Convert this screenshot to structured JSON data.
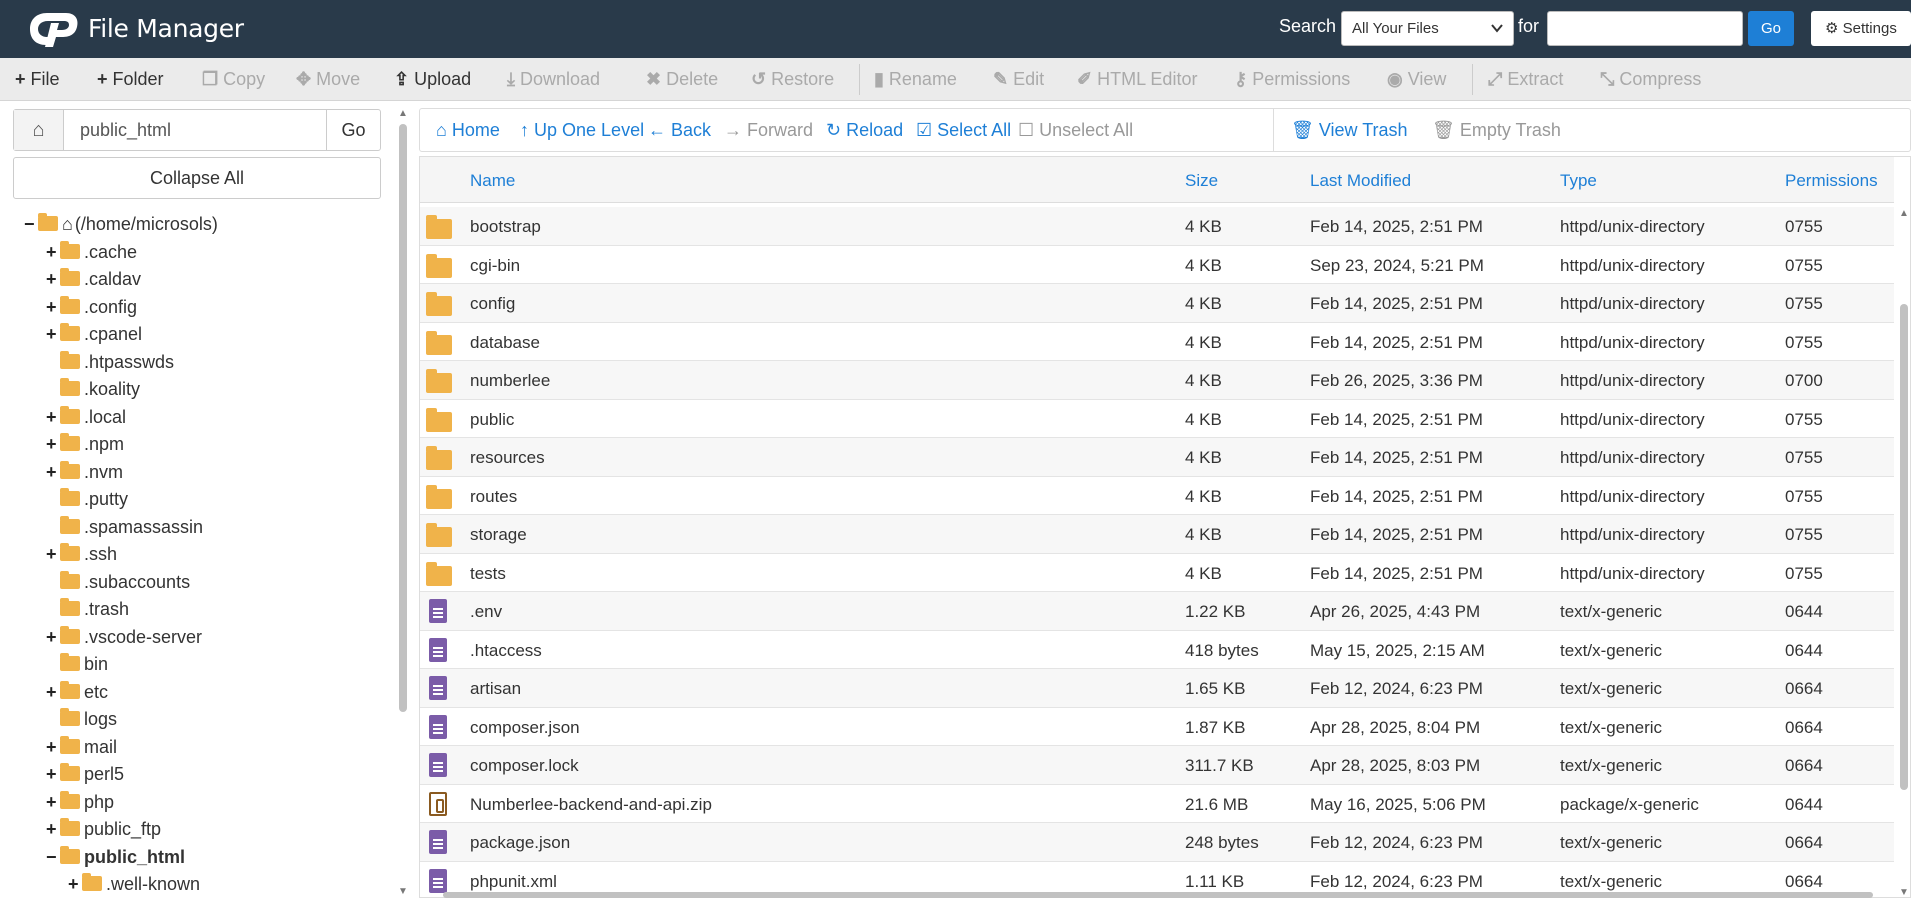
{
  "header": {
    "title": "File Manager",
    "search_label": "Search",
    "search_scope": "All Your Files",
    "for_label": "for",
    "search_value": "",
    "go_label": "Go",
    "settings_label": "Settings",
    "bg_color": "#293a4a",
    "accent_color": "#1e7fd6"
  },
  "toolbar": {
    "items": [
      {
        "label": "File",
        "icon": "plus-icon",
        "enabled": true
      },
      {
        "label": "Folder",
        "icon": "plus-icon",
        "enabled": true
      },
      {
        "label": "Copy",
        "icon": "copy-icon",
        "enabled": false
      },
      {
        "label": "Move",
        "icon": "move-icon",
        "enabled": false
      },
      {
        "label": "Upload",
        "icon": "upload-icon",
        "enabled": true
      },
      {
        "label": "Download",
        "icon": "download-icon",
        "enabled": false
      },
      {
        "label": "Delete",
        "icon": "close-icon",
        "enabled": false
      },
      {
        "label": "Restore",
        "icon": "restore-icon",
        "enabled": false
      },
      {
        "label": "Rename",
        "icon": "file-icon",
        "enabled": false
      },
      {
        "label": "Edit",
        "icon": "pencil-icon",
        "enabled": false
      },
      {
        "label": "HTML Editor",
        "icon": "edit-icon",
        "enabled": false
      },
      {
        "label": "Permissions",
        "icon": "key-icon",
        "enabled": false
      },
      {
        "label": "View",
        "icon": "eye-icon",
        "enabled": false
      },
      {
        "label": "Extract",
        "icon": "expand-icon",
        "enabled": false
      },
      {
        "label": "Compress",
        "icon": "compress-icon",
        "enabled": false
      }
    ]
  },
  "sidebar": {
    "path_value": "public_html",
    "go_label": "Go",
    "collapse_label": "Collapse All",
    "tree": [
      {
        "label": "(/home/microsols)",
        "toggle": "−",
        "level": 0,
        "home": true
      },
      {
        "label": ".cache",
        "toggle": "+",
        "level": 1
      },
      {
        "label": ".caldav",
        "toggle": "+",
        "level": 1
      },
      {
        "label": ".config",
        "toggle": "+",
        "level": 1
      },
      {
        "label": ".cpanel",
        "toggle": "+",
        "level": 1
      },
      {
        "label": ".htpasswds",
        "toggle": "",
        "level": 1
      },
      {
        "label": ".koality",
        "toggle": "",
        "level": 1
      },
      {
        "label": ".local",
        "toggle": "+",
        "level": 1
      },
      {
        "label": ".npm",
        "toggle": "+",
        "level": 1
      },
      {
        "label": ".nvm",
        "toggle": "+",
        "level": 1
      },
      {
        "label": ".putty",
        "toggle": "",
        "level": 1
      },
      {
        "label": ".spamassassin",
        "toggle": "",
        "level": 1
      },
      {
        "label": ".ssh",
        "toggle": "+",
        "level": 1
      },
      {
        "label": ".subaccounts",
        "toggle": "",
        "level": 1
      },
      {
        "label": ".trash",
        "toggle": "",
        "level": 1
      },
      {
        "label": ".vscode-server",
        "toggle": "+",
        "level": 1
      },
      {
        "label": "bin",
        "toggle": "",
        "level": 1
      },
      {
        "label": "etc",
        "toggle": "+",
        "level": 1
      },
      {
        "label": "logs",
        "toggle": "",
        "level": 1
      },
      {
        "label": "mail",
        "toggle": "+",
        "level": 1
      },
      {
        "label": "perl5",
        "toggle": "+",
        "level": 1
      },
      {
        "label": "php",
        "toggle": "+",
        "level": 1
      },
      {
        "label": "public_ftp",
        "toggle": "+",
        "level": 1
      },
      {
        "label": "public_html",
        "toggle": "−",
        "level": 1,
        "bold": true
      },
      {
        "label": ".well-known",
        "toggle": "+",
        "level": 2
      }
    ]
  },
  "nav": {
    "items": [
      {
        "label": "Home",
        "icon": "home-icon",
        "enabled": true
      },
      {
        "label": "Up One Level",
        "icon": "arrow-up-icon",
        "enabled": true
      },
      {
        "label": "Back",
        "icon": "arrow-left-icon",
        "enabled": true
      },
      {
        "label": "Forward",
        "icon": "arrow-right-icon",
        "enabled": false
      },
      {
        "label": "Reload",
        "icon": "reload-icon",
        "enabled": true
      },
      {
        "label": "Select All",
        "icon": "checkbox-checked-icon",
        "enabled": true
      },
      {
        "label": "Unselect All",
        "icon": "checkbox-icon",
        "enabled": false
      },
      {
        "label": "View Trash",
        "icon": "trash-icon",
        "enabled": true
      },
      {
        "label": "Empty Trash",
        "icon": "trash-icon",
        "enabled": false
      }
    ]
  },
  "table": {
    "columns": [
      "Name",
      "Size",
      "Last Modified",
      "Type",
      "Permissions"
    ],
    "rows": [
      {
        "icon": "folder",
        "name": "bootstrap",
        "size": "4 KB",
        "modified": "Feb 14, 2025, 2:51 PM",
        "type": "httpd/unix-directory",
        "perms": "0755"
      },
      {
        "icon": "folder",
        "name": "cgi-bin",
        "size": "4 KB",
        "modified": "Sep 23, 2024, 5:21 PM",
        "type": "httpd/unix-directory",
        "perms": "0755"
      },
      {
        "icon": "folder",
        "name": "config",
        "size": "4 KB",
        "modified": "Feb 14, 2025, 2:51 PM",
        "type": "httpd/unix-directory",
        "perms": "0755"
      },
      {
        "icon": "folder",
        "name": "database",
        "size": "4 KB",
        "modified": "Feb 14, 2025, 2:51 PM",
        "type": "httpd/unix-directory",
        "perms": "0755"
      },
      {
        "icon": "folder",
        "name": "numberlee",
        "size": "4 KB",
        "modified": "Feb 26, 2025, 3:36 PM",
        "type": "httpd/unix-directory",
        "perms": "0700"
      },
      {
        "icon": "folder",
        "name": "public",
        "size": "4 KB",
        "modified": "Feb 14, 2025, 2:51 PM",
        "type": "httpd/unix-directory",
        "perms": "0755"
      },
      {
        "icon": "folder",
        "name": "resources",
        "size": "4 KB",
        "modified": "Feb 14, 2025, 2:51 PM",
        "type": "httpd/unix-directory",
        "perms": "0755"
      },
      {
        "icon": "folder",
        "name": "routes",
        "size": "4 KB",
        "modified": "Feb 14, 2025, 2:51 PM",
        "type": "httpd/unix-directory",
        "perms": "0755"
      },
      {
        "icon": "folder",
        "name": "storage",
        "size": "4 KB",
        "modified": "Feb 14, 2025, 2:51 PM",
        "type": "httpd/unix-directory",
        "perms": "0755"
      },
      {
        "icon": "folder",
        "name": "tests",
        "size": "4 KB",
        "modified": "Feb 14, 2025, 2:51 PM",
        "type": "httpd/unix-directory",
        "perms": "0755"
      },
      {
        "icon": "file",
        "name": ".env",
        "size": "1.22 KB",
        "modified": "Apr 26, 2025, 4:43 PM",
        "type": "text/x-generic",
        "perms": "0644"
      },
      {
        "icon": "file",
        "name": ".htaccess",
        "size": "418 bytes",
        "modified": "May 15, 2025, 2:15 AM",
        "type": "text/x-generic",
        "perms": "0644"
      },
      {
        "icon": "file",
        "name": "artisan",
        "size": "1.65 KB",
        "modified": "Feb 12, 2024, 6:23 PM",
        "type": "text/x-generic",
        "perms": "0664"
      },
      {
        "icon": "file",
        "name": "composer.json",
        "size": "1.87 KB",
        "modified": "Apr 28, 2025, 8:04 PM",
        "type": "text/x-generic",
        "perms": "0664"
      },
      {
        "icon": "file",
        "name": "composer.lock",
        "size": "311.7 KB",
        "modified": "Apr 28, 2025, 8:03 PM",
        "type": "text/x-generic",
        "perms": "0664"
      },
      {
        "icon": "zip",
        "name": "Numberlee-backend-and-api.zip",
        "size": "21.6 MB",
        "modified": "May 16, 2025, 5:06 PM",
        "type": "package/x-generic",
        "perms": "0644"
      },
      {
        "icon": "file",
        "name": "package.json",
        "size": "248 bytes",
        "modified": "Feb 12, 2024, 6:23 PM",
        "type": "text/x-generic",
        "perms": "0664"
      },
      {
        "icon": "file",
        "name": "phpunit.xml",
        "size": "1.11 KB",
        "modified": "Feb 12, 2024, 6:23 PM",
        "type": "text/x-generic",
        "perms": "0664"
      }
    ]
  }
}
